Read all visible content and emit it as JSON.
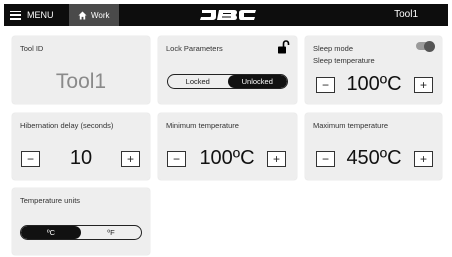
{
  "topbar": {
    "menu_label": "MENU",
    "work_label": "Work",
    "brand": "JBC",
    "tool_name": "Tool1"
  },
  "tool_id": {
    "title": "Tool ID",
    "value": "Tool1"
  },
  "lock_parameters": {
    "title": "Lock Parameters",
    "options": [
      "Locked",
      "Unlocked"
    ],
    "selected": "Unlocked"
  },
  "sleep_mode": {
    "title": "Sleep mode",
    "subtitle": "Sleep temperature",
    "enabled": true,
    "value": "100ºC",
    "minus": "−",
    "plus": "+"
  },
  "hibernation": {
    "title": "Hibernation delay (seconds)",
    "value": "10",
    "minus": "−",
    "plus": "+"
  },
  "min_temp": {
    "title": "Minimum temperature",
    "value": "100ºC",
    "minus": "−",
    "plus": "+"
  },
  "max_temp": {
    "title": "Maximum temperature",
    "value": "450ºC",
    "minus": "−",
    "plus": "+"
  },
  "temp_units": {
    "title": "Temperature units",
    "options": [
      "ºC",
      "ºF"
    ],
    "selected": "ºC"
  }
}
